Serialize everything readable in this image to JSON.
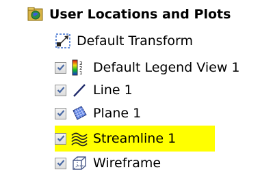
{
  "tree": {
    "root": {
      "label": "User Locations and Plots",
      "icon": "folder-globe-icon",
      "expanded": true
    },
    "items": [
      {
        "label": "Default Transform",
        "icon": "transform-icon",
        "has_checkbox": false,
        "checked": false,
        "highlighted": false
      },
      {
        "label": "Default Legend View 1",
        "icon": "legend-icon",
        "has_checkbox": true,
        "checked": true,
        "highlighted": false
      },
      {
        "label": "Line 1",
        "icon": "line-icon",
        "has_checkbox": true,
        "checked": true,
        "highlighted": false
      },
      {
        "label": "Plane 1",
        "icon": "plane-icon",
        "has_checkbox": true,
        "checked": true,
        "highlighted": false
      },
      {
        "label": "Streamline 1",
        "icon": "streamline-icon",
        "has_checkbox": true,
        "checked": true,
        "highlighted": true
      },
      {
        "label": "Wireframe",
        "icon": "wireframe-icon",
        "has_checkbox": true,
        "checked": true,
        "highlighted": false
      }
    ]
  },
  "colors": {
    "highlight": "#ffff00",
    "check": "#4a6aa5",
    "accent_blue": "#3b5bdb"
  }
}
